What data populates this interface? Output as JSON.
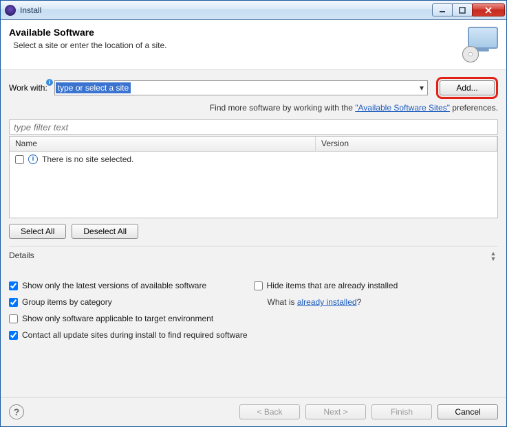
{
  "window": {
    "title": "Install"
  },
  "header": {
    "title": "Available Software",
    "subtitle": "Select a site or enter the location of a site."
  },
  "workwith": {
    "label": "Work with:",
    "placeholder": "type or select a site",
    "add_label": "Add..."
  },
  "hint": {
    "prefix": "Find more software by working with the ",
    "link": "\"Available Software Sites\"",
    "suffix": " preferences."
  },
  "filter": {
    "placeholder": "type filter text"
  },
  "tree": {
    "columns": {
      "name": "Name",
      "version": "Version"
    },
    "empty_message": "There is no site selected."
  },
  "selection": {
    "select_all": "Select All",
    "deselect_all": "Deselect All"
  },
  "details": {
    "label": "Details"
  },
  "options": {
    "latest": "Show only the latest versions of available software",
    "hide_installed": "Hide items that are already installed",
    "group": "Group items by category",
    "whatis_prefix": "What is ",
    "whatis_link": "already installed",
    "whatis_suffix": "?",
    "applicable": "Show only software applicable to target environment",
    "contact_all": "Contact all update sites during install to find required software"
  },
  "footer": {
    "back": "< Back",
    "next": "Next >",
    "finish": "Finish",
    "cancel": "Cancel"
  }
}
